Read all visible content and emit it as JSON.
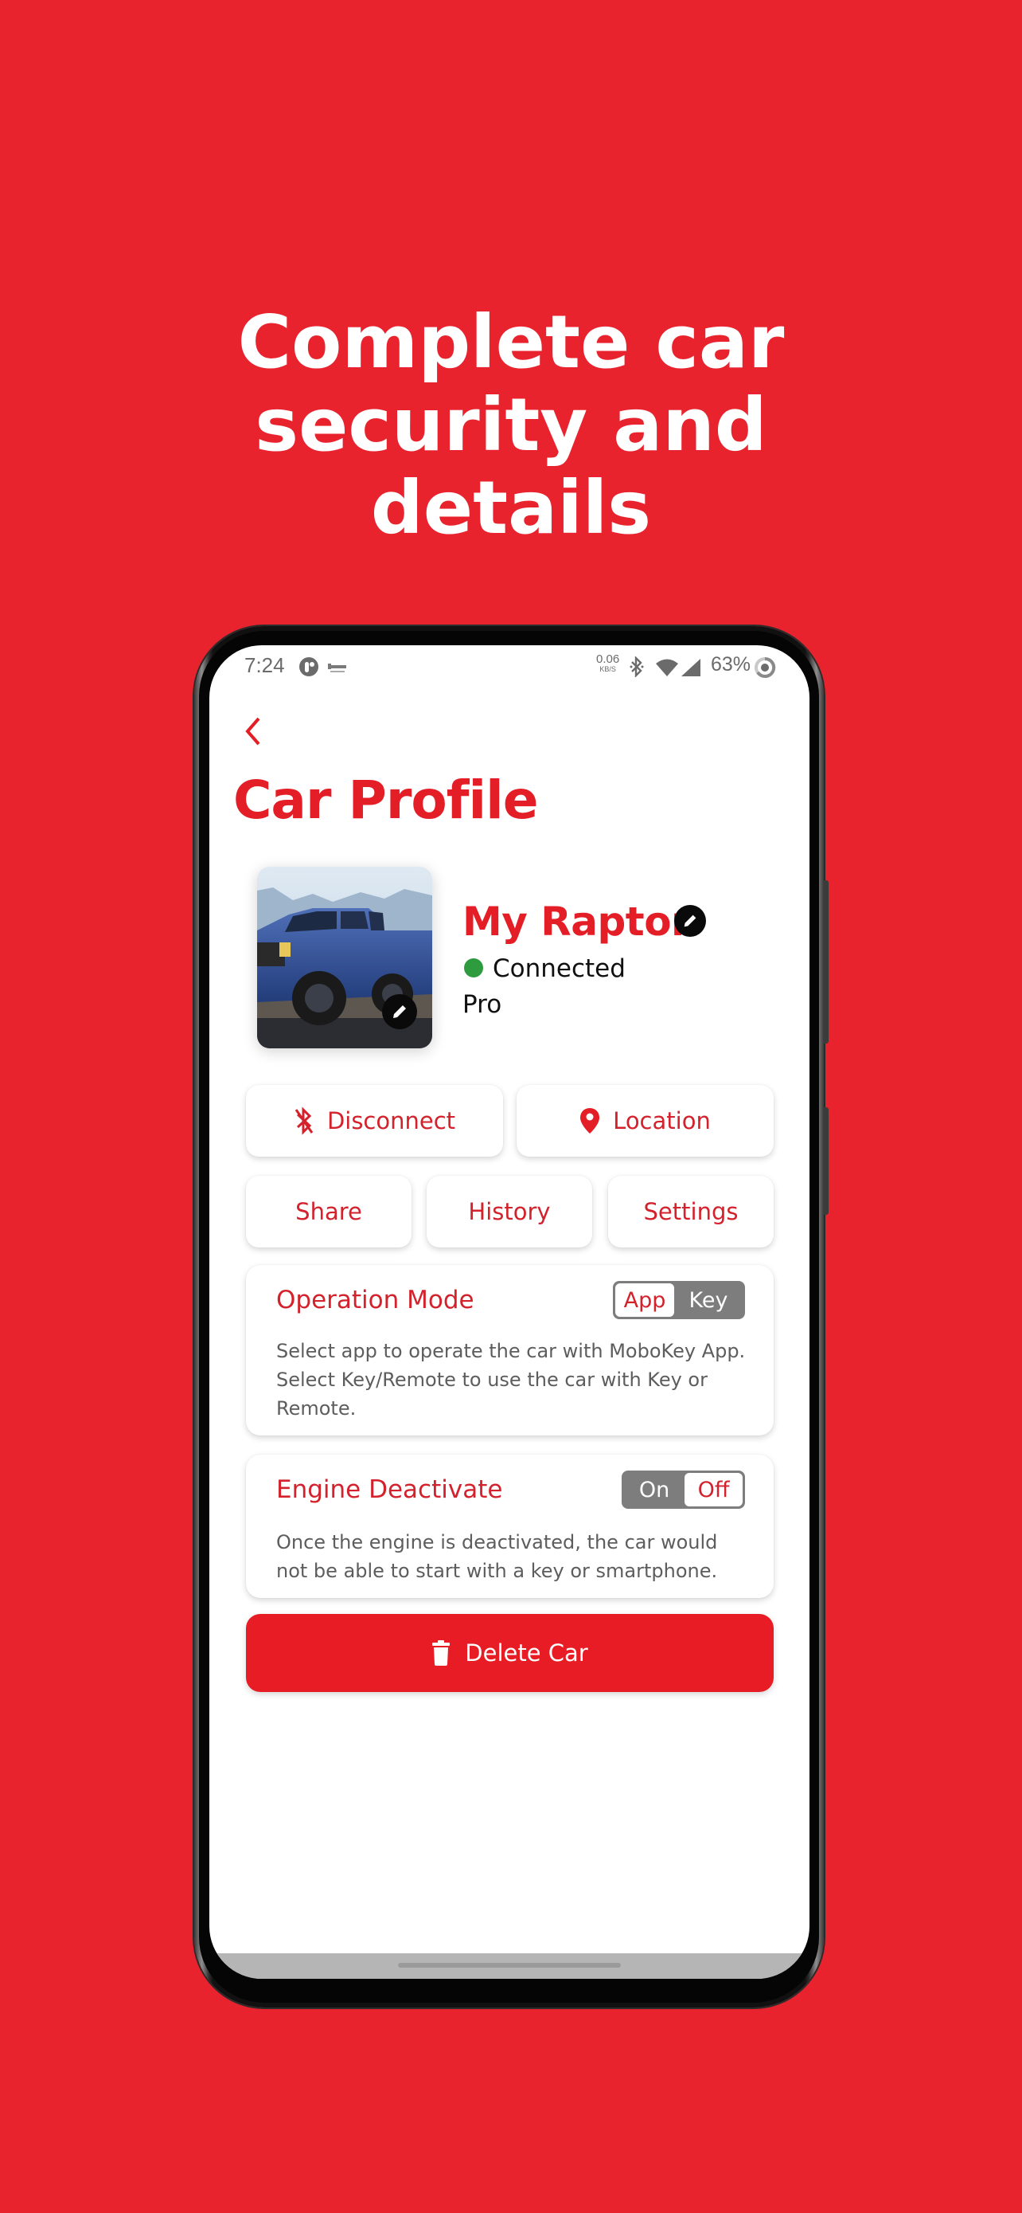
{
  "promo": {
    "headline_lines": [
      "Complete car",
      "security and",
      "details"
    ],
    "background_color": "#e8232e"
  },
  "status_bar": {
    "time": "7:24",
    "left_icons": [
      "app-circle-icon",
      "mobokey-key-icon"
    ],
    "net_speed_value": "0.06",
    "net_speed_unit": "KB/S",
    "right_icons": [
      "bluetooth-icon",
      "wifi-icon",
      "cell-signal-icon",
      "battery-ring-icon"
    ],
    "battery": "63%"
  },
  "header": {
    "back_icon": "chevron-left-icon",
    "title": "Car Profile"
  },
  "car": {
    "name": "My Raptor",
    "status": "Connected",
    "status_color": "#2e9b3e",
    "plan": "Pro",
    "photo_alt": "Blue pickup truck",
    "edit_icon": "pencil-icon"
  },
  "actions": {
    "primary": [
      {
        "label": "Disconnect",
        "icon": "bluetooth-disabled-icon"
      },
      {
        "label": "Location",
        "icon": "map-pin-icon"
      }
    ],
    "secondary": [
      {
        "label": "Share"
      },
      {
        "label": "History"
      },
      {
        "label": "Settings"
      }
    ]
  },
  "operation_mode": {
    "title": "Operation Mode",
    "options": [
      "App",
      "Key"
    ],
    "selected": "App",
    "description": "Select app to operate the car with MoboKey App. Select Key/Remote to use the car with Key or Remote."
  },
  "engine_deactivate": {
    "title": "Engine Deactivate",
    "options": [
      "On",
      "Off"
    ],
    "selected": "Off",
    "description": "Once the engine is deactivated, the car would not be able to start with a key or smartphone."
  },
  "delete": {
    "label": "Delete Car",
    "icon": "trash-icon"
  },
  "colors": {
    "accent": "#e41e26",
    "text_accent": "#d3222c",
    "toggle_bg": "#7d7d7d",
    "delete_bg": "#e81c24"
  }
}
